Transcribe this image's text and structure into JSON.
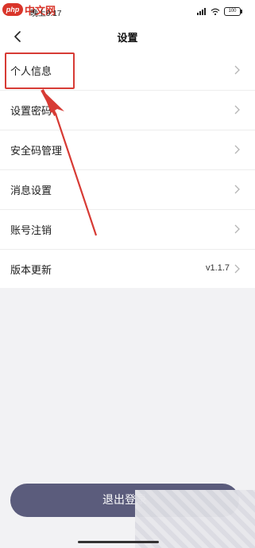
{
  "status": {
    "time": "晚上9:17",
    "battery": "100"
  },
  "watermark": {
    "badge": "php",
    "text": "中文网"
  },
  "header": {
    "title": "设置"
  },
  "menu": {
    "items": [
      {
        "label": "个人信息",
        "value": ""
      },
      {
        "label": "设置密码",
        "value": ""
      },
      {
        "label": "安全码管理",
        "value": ""
      },
      {
        "label": "消息设置",
        "value": ""
      },
      {
        "label": "账号注销",
        "value": ""
      },
      {
        "label": "版本更新",
        "value": "v1.1.7"
      }
    ]
  },
  "footer": {
    "logout_label": "退出登录"
  },
  "colors": {
    "accent": "#5b5c7c",
    "annotation": "#d73b35",
    "background": "#f2f2f4"
  },
  "icons": {
    "back": "chevron-left-icon",
    "row": "chevron-right-icon"
  }
}
